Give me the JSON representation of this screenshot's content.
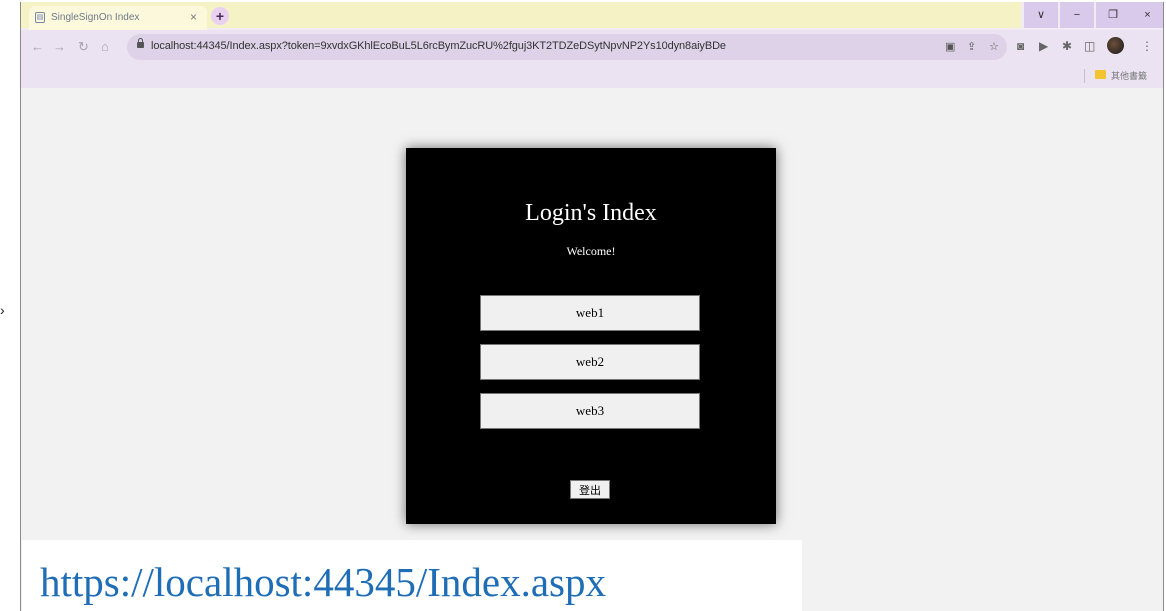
{
  "browser": {
    "tab_title": "SingleSignOn Index",
    "tab_close": "×",
    "new_tab": "+",
    "url": "localhost:44345/Index.aspx?token=9xvdxGKhlEcoBuL5L6rcBymZucRU%2fguj3KT2TDZeDSytNpvNP2Ys10dyn8aiyBDe",
    "bookmark_folder": "其他書籤",
    "window_controls": [
      "∨",
      "−",
      "❐",
      "×"
    ]
  },
  "page": {
    "title": "Login's Index",
    "subtitle": "Welcome!",
    "buttons": [
      "web1",
      "web2",
      "web3"
    ],
    "logout_label": "登出"
  },
  "caption": {
    "text": "https://localhost:44345/Index.aspx"
  }
}
